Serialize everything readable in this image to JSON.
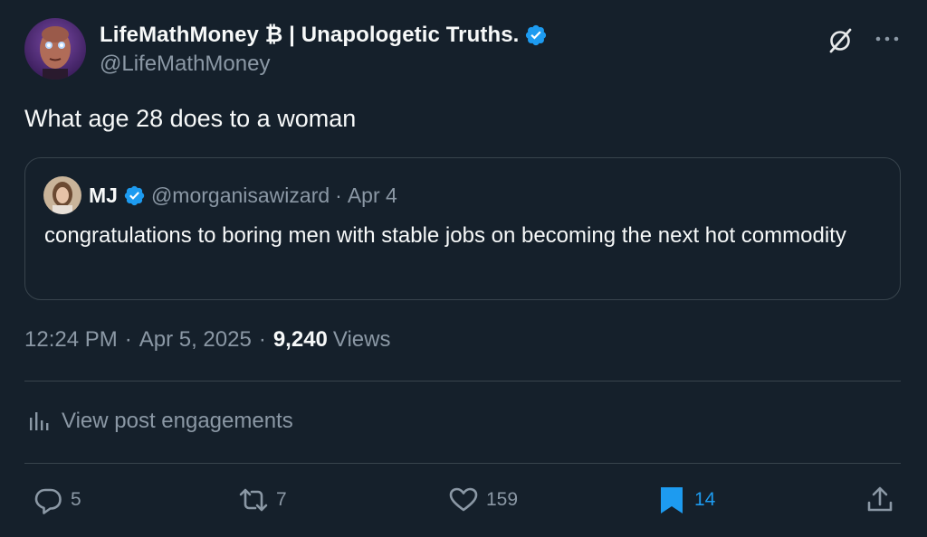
{
  "author": {
    "name": "LifeMathMoney ₿ | Unapologetic Truths.",
    "handle": "@LifeMathMoney",
    "verified": true
  },
  "tweet": {
    "text": "What age 28 does to a woman"
  },
  "quote": {
    "name": "MJ",
    "handle": "@morganisawizard",
    "separator": "·",
    "date": "Apr 4",
    "text": "congratulations to boring men with stable jobs on becoming the next hot commodity",
    "verified": true
  },
  "meta": {
    "time": "12:24 PM",
    "dot1": "·",
    "date": "Apr 5, 2025",
    "dot2": "·",
    "views_count": "9,240",
    "views_label": "Views"
  },
  "engagements": {
    "label": "View post engagements"
  },
  "actions": {
    "replies": "5",
    "reposts": "7",
    "likes": "159",
    "bookmarks": "14"
  },
  "colors": {
    "background": "#15202b",
    "text": "#f7f9f9",
    "muted": "#8b98a5",
    "border": "#38444d",
    "accent": "#1d9bf0"
  },
  "icons": {
    "verified": "verified-badge-icon",
    "grok": "grok-icon",
    "more": "more-icon",
    "engagements": "bar-chart-icon",
    "reply": "reply-icon",
    "repost": "repost-icon",
    "like": "heart-icon",
    "bookmark": "bookmark-icon",
    "share": "share-icon"
  }
}
